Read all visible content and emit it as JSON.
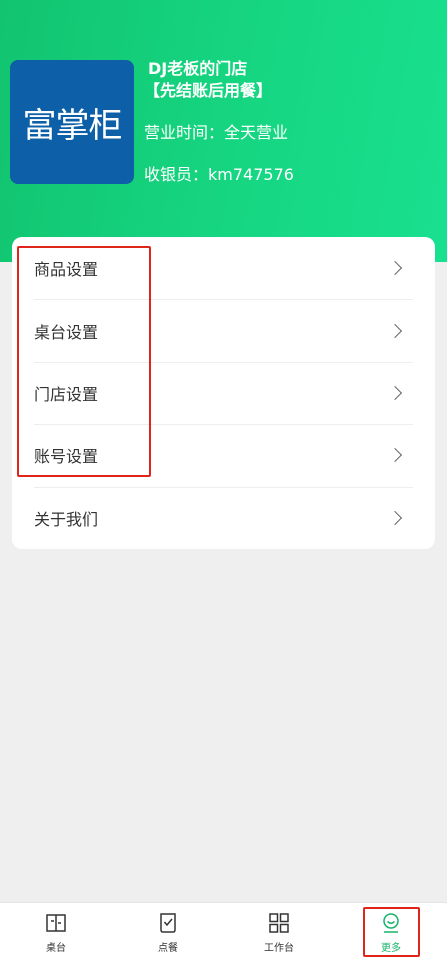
{
  "store": {
    "logo_text": "富掌柜",
    "name": "DJ老板的门店",
    "mode": "【先结账后用餐】",
    "hours": "营业时间：全天营业",
    "cashier": "收银员：km747576"
  },
  "menu": {
    "items": [
      {
        "label": "商品设置"
      },
      {
        "label": "桌台设置"
      },
      {
        "label": "门店设置"
      },
      {
        "label": "账号设置"
      },
      {
        "label": "关于我们"
      }
    ]
  },
  "tabbar": {
    "items": [
      {
        "label": "桌台",
        "icon": "table-icon"
      },
      {
        "label": "点餐",
        "icon": "order-icon"
      },
      {
        "label": "工作台",
        "icon": "workbench-icon"
      },
      {
        "label": "更多",
        "icon": "more-icon",
        "active": true
      }
    ]
  },
  "colors": {
    "header_green": "#16d682",
    "logo_blue": "#0d5fa8",
    "active_tab": "#17b46a",
    "highlight_red": "#e0251b"
  }
}
